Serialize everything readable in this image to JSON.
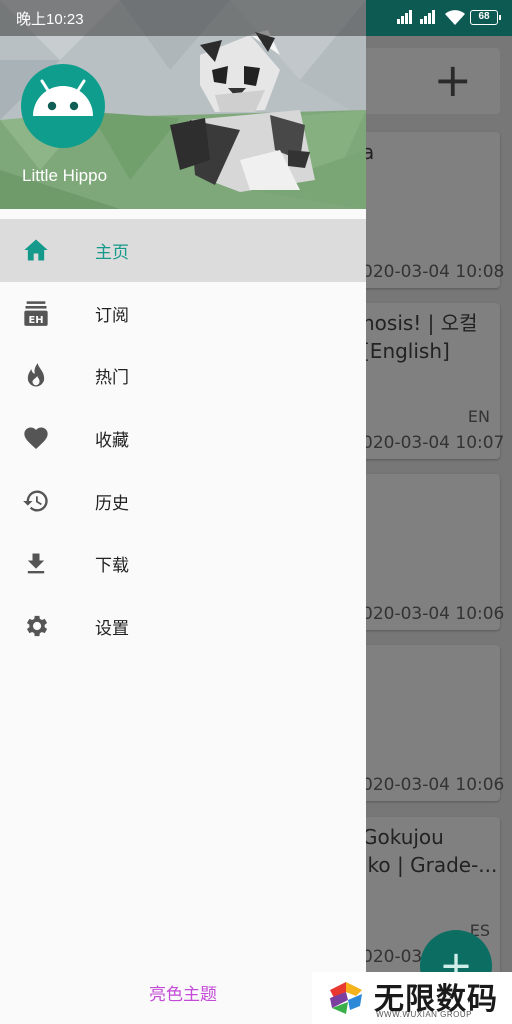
{
  "status_bar": {
    "time": "晚上10:23",
    "battery": "68"
  },
  "drawer": {
    "username": "Little Hippo",
    "nav_items": [
      {
        "label": "主页",
        "icon": "home-icon",
        "active": true
      },
      {
        "label": "订阅",
        "icon": "eh-subscribe-icon",
        "active": false
      },
      {
        "label": "热门",
        "icon": "fire-icon",
        "active": false
      },
      {
        "label": "收藏",
        "icon": "heart-icon",
        "active": false
      },
      {
        "label": "历史",
        "icon": "history-icon",
        "active": false
      },
      {
        "label": "下载",
        "icon": "download-icon",
        "active": false
      },
      {
        "label": "设置",
        "icon": "gear-icon",
        "active": false
      }
    ],
    "theme_link": "亮色主题"
  },
  "background": {
    "cards": [
      {
        "title_lines": [
          "a"
        ],
        "lang": "",
        "date": "020-03-04 10:08"
      },
      {
        "title_lines": [
          "nosis! | 오컬",
          "[English]"
        ],
        "lang": "EN",
        "date": "020-03-04 10:07"
      },
      {
        "title_lines": [
          ""
        ],
        "lang": "",
        "date": "020-03-04 10:06"
      },
      {
        "title_lines": [
          ""
        ],
        "lang": "",
        "date": "020-03-04 10:06"
      },
      {
        "title_lines": [
          "Gokujou",
          "iko | Grade-..."
        ],
        "lang": "ES",
        "date": "020-03-"
      }
    ]
  },
  "watermark": {
    "text": "无限数码",
    "sub": "WWW.WUXIAN GROUP"
  },
  "colors": {
    "accent": "#14998a",
    "theme_link": "#c44ad8",
    "statusbar_right": "#0d5a52"
  }
}
